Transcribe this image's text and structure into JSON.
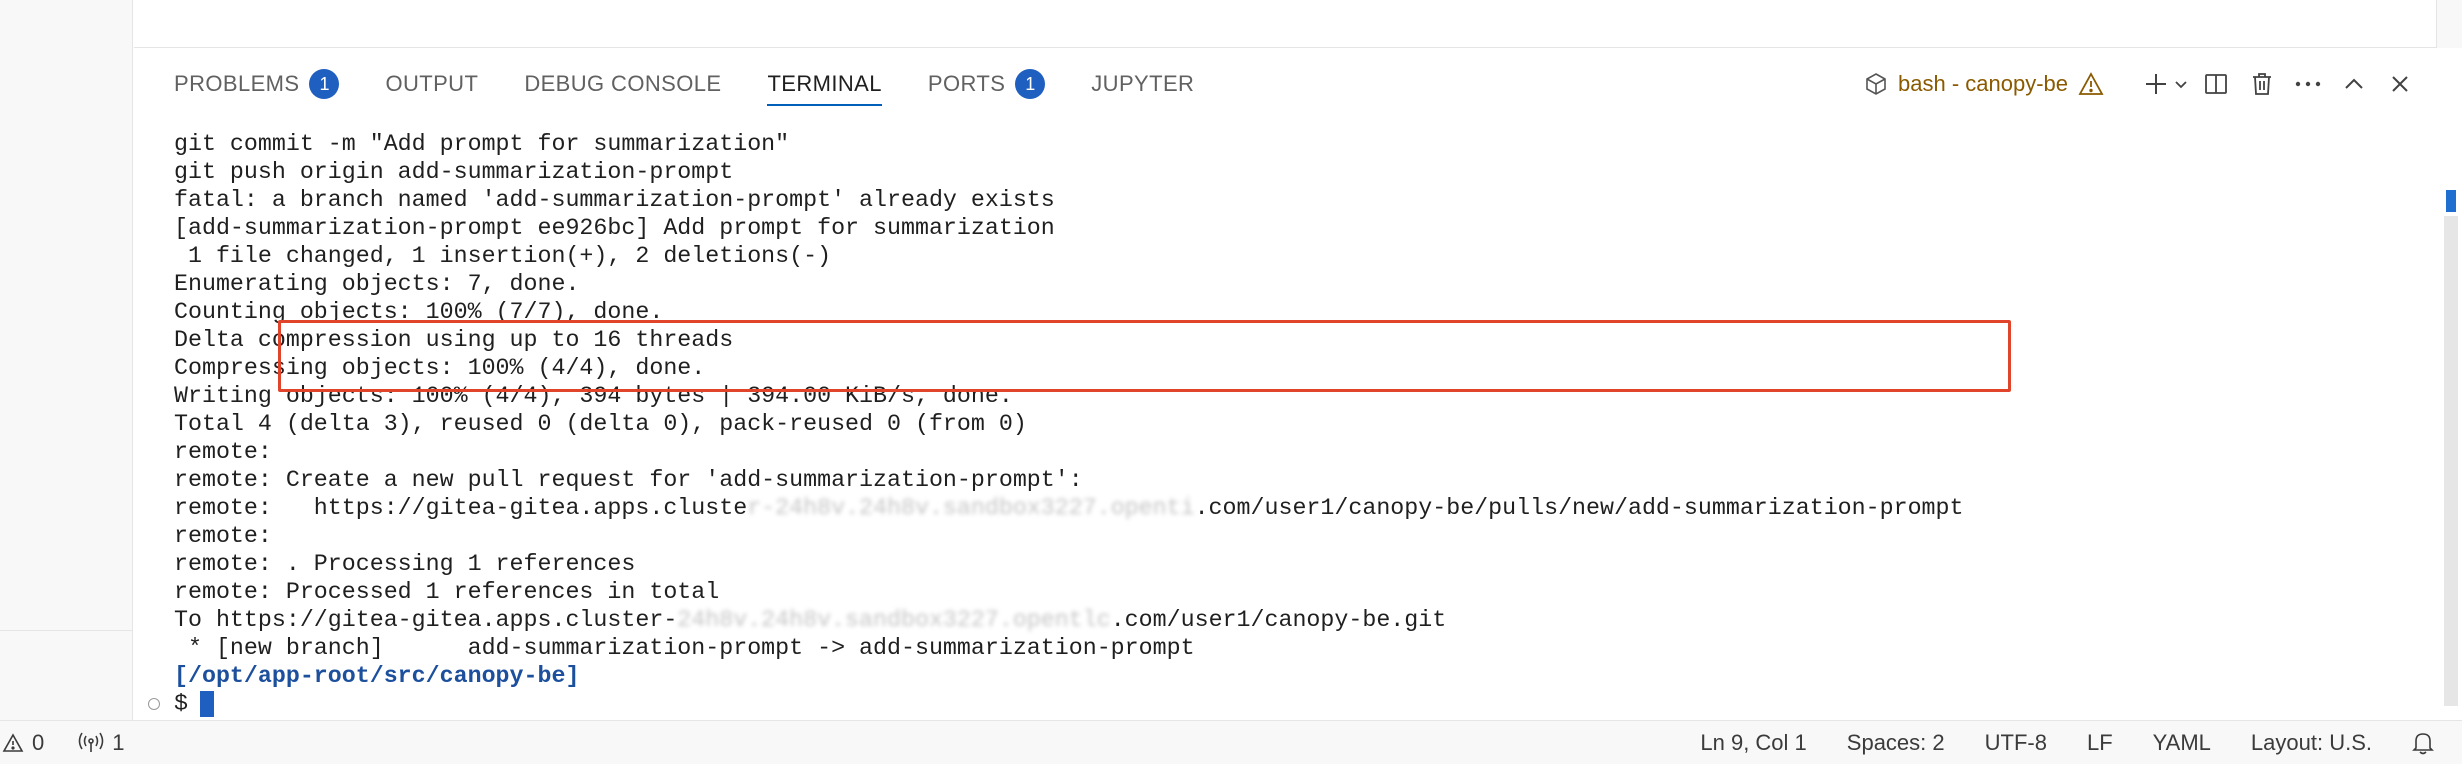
{
  "panel": {
    "tabs": [
      {
        "label": "PROBLEMS",
        "badge": "1"
      },
      {
        "label": "OUTPUT"
      },
      {
        "label": "DEBUG CONSOLE"
      },
      {
        "label": "TERMINAL",
        "active": true
      },
      {
        "label": "PORTS",
        "badge": "1"
      },
      {
        "label": "JUPYTER"
      }
    ],
    "terminal_name": "bash - canopy-be"
  },
  "terminal": {
    "lines": [
      "git commit -m \"Add prompt for summarization\"",
      "git push origin add-summarization-prompt",
      "fatal: a branch named 'add-summarization-prompt' already exists",
      "[add-summarization-prompt ee926bc] Add prompt for summarization",
      " 1 file changed, 1 insertion(+), 2 deletions(-)",
      "Enumerating objects: 7, done.",
      "Counting objects: 100% (7/7), done.",
      "Delta compression using up to 16 threads",
      "Compressing objects: 100% (4/4), done.",
      "Writing objects: 100% (4/4), 394 bytes | 394.00 KiB/s, done.",
      "Total 4 (delta 3), reused 0 (delta 0), pack-reused 0 (from 0)",
      "remote:",
      "remote: Create a new pull request for 'add-summarization-prompt':"
    ],
    "url_line": {
      "prefix": "remote:   https://gitea-gitea.apps.cluste",
      "redacted": "r-24h8v.24h8v.sandbox3227.openti",
      "suffix": ".com/user1/canopy-be/pulls/new/add-summarization-prompt"
    },
    "lines_after": [
      "remote:",
      "remote: . Processing 1 references",
      "remote: Processed 1 references in total"
    ],
    "to_line": {
      "prefix": "To https://gitea-gitea.apps.cluster-",
      "redacted": "24h8v.24h8v.sandbox3227.opentlc",
      "suffix": ".com/user1/canopy-be.git"
    },
    "branch_line": " * [new branch]      add-summarization-prompt -> add-summarization-prompt",
    "prompt_path": "[/opt/app-root/src/canopy-be]",
    "prompt_symbol": "$"
  },
  "statusbar": {
    "warnings": "0",
    "ports": "1",
    "position": "Ln 9, Col 1",
    "spaces": "Spaces: 2",
    "encoding": "UTF-8",
    "eol": "LF",
    "language": "YAML",
    "layout": "Layout: U.S."
  },
  "colors": {
    "accent": "#005fb8",
    "badge": "#1f5fbf",
    "highlight_box": "#e0442b",
    "prompt_path": "#1c4f9c",
    "terminal_name": "#8a5a00"
  }
}
